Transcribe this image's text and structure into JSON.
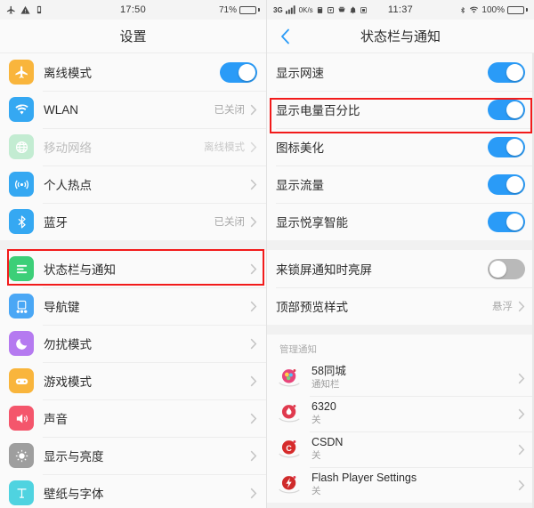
{
  "left": {
    "status": {
      "time": "17:50",
      "battery_pct": "71%",
      "icons": [
        "airplane-icon",
        "warning-icon",
        "vibrate-icon"
      ]
    },
    "nav": {
      "title": "设置"
    },
    "groups": [
      {
        "rows": [
          {
            "icon": "airplane-icon",
            "icon_bg": "#f9b53c",
            "label": "离线模式",
            "control": "toggle",
            "toggle_on": true
          },
          {
            "icon": "wifi-icon",
            "icon_bg": "#35a8f2",
            "label": "WLAN",
            "value": "已关闭",
            "control": "chevron"
          },
          {
            "icon": "globe-icon",
            "icon_bg": "#c3ecd2",
            "label": "移动网络",
            "value": "离线模式",
            "control": "chevron",
            "disabled": true
          },
          {
            "icon": "hotspot-icon",
            "icon_bg": "#35a8f2",
            "label": "个人热点",
            "value": "",
            "control": "chevron"
          },
          {
            "icon": "bluetooth-icon",
            "icon_bg": "#35a8f2",
            "label": "蓝牙",
            "value": "已关闭",
            "control": "chevron"
          }
        ]
      },
      {
        "rows": [
          {
            "icon": "statusbar-icon",
            "icon_bg": "#3ccf78",
            "label": "状态栏与通知",
            "value": "",
            "control": "chevron",
            "highlight": true
          },
          {
            "icon": "navkeys-icon",
            "icon_bg": "#4aa7f5",
            "label": "导航键",
            "value": "",
            "control": "chevron"
          },
          {
            "icon": "moon-icon",
            "icon_bg": "#b57af0",
            "label": "勿扰模式",
            "value": "",
            "control": "chevron"
          },
          {
            "icon": "gamepad-icon",
            "icon_bg": "#f9b53c",
            "label": "游戏模式",
            "value": "",
            "control": "chevron"
          },
          {
            "icon": "speaker-icon",
            "icon_bg": "#f4566c",
            "label": "声音",
            "value": "",
            "control": "chevron"
          },
          {
            "icon": "brightness-icon",
            "icon_bg": "#9e9e9e",
            "label": "显示与亮度",
            "value": "",
            "control": "chevron"
          },
          {
            "icon": "font-icon",
            "icon_bg": "#4fd3e0",
            "label": "壁纸与字体",
            "value": "",
            "control": "chevron"
          }
        ]
      }
    ]
  },
  "right": {
    "status": {
      "network": "3G",
      "speed": "0K/s",
      "time": "11:37",
      "battery_pct": "100%",
      "icons": [
        "signal-icon",
        "alarm-icon",
        "sync-icon",
        "inbox-icon",
        "bell-icon",
        "sdcard-icon",
        "bluetooth-icon",
        "wifi-icon"
      ]
    },
    "nav": {
      "title": "状态栏与通知",
      "back": "back-chevron-icon"
    },
    "group1": {
      "rows": [
        {
          "label": "显示网速",
          "toggle_on": true
        },
        {
          "label": "显示电量百分比",
          "toggle_on": true,
          "highlight": true
        },
        {
          "label": "图标美化",
          "toggle_on": true
        },
        {
          "label": "显示流量",
          "toggle_on": true
        },
        {
          "label": "显示悦享智能",
          "toggle_on": true
        }
      ]
    },
    "group2": {
      "rows": [
        {
          "label": "来锁屏通知时亮屏",
          "control": "toggle",
          "toggle_on": false
        },
        {
          "label": "顶部预览样式",
          "control": "chevron",
          "value": "悬浮"
        }
      ]
    },
    "manage": {
      "header": "管理通知",
      "apps": [
        {
          "name": "58同城",
          "sub": "通知栏",
          "icon_color": "#e8447a"
        },
        {
          "name": "6320",
          "sub": "关",
          "icon_color": "#e03a4e"
        },
        {
          "name": "CSDN",
          "sub": "关",
          "icon_color": "#d62b2b"
        },
        {
          "name": "Flash Player Settings",
          "sub": "关",
          "icon_color": "#cf2a2a"
        }
      ]
    }
  },
  "colors": {
    "accent": "#2a9bf7",
    "highlight": "#f21b1b",
    "page_bg": "#f1f1f1",
    "card_bg": "#fafafa"
  }
}
